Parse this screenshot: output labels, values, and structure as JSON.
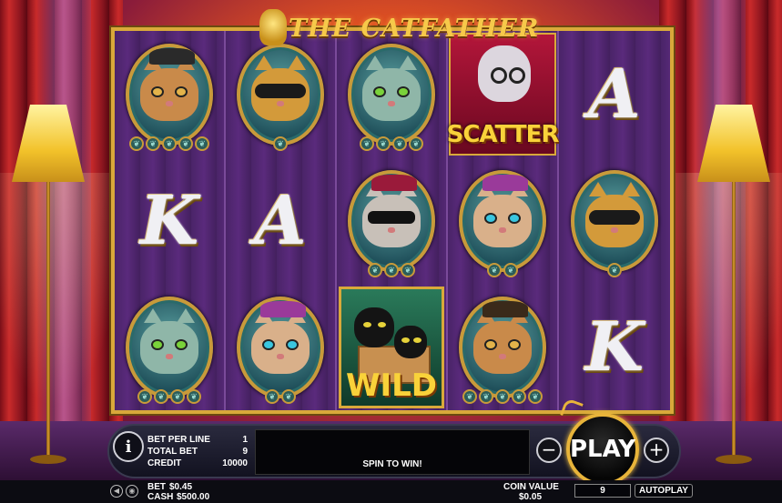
{
  "game": {
    "title": "THE CATFATHER"
  },
  "reels": [
    [
      {
        "symbol": "cat-monocle-bowler",
        "paw_count": 5,
        "colors": {
          "fur": "#c98a4a",
          "eye": "#e3b34a",
          "hat": "#2a2a2a"
        }
      },
      {
        "symbol": "letter",
        "text": "K"
      },
      {
        "symbol": "cat-tabby-green",
        "paw_count": 4,
        "colors": {
          "fur": "#8fb6a8",
          "eye": "#7ad23a"
        }
      }
    ],
    [
      {
        "symbol": "cat-masked-orange",
        "paw_count": 1,
        "colors": {
          "fur": "#d39a3a",
          "eye": "#f2a020"
        }
      },
      {
        "symbol": "letter",
        "text": "A"
      },
      {
        "symbol": "cat-siamese-beret",
        "paw_count": 2,
        "colors": {
          "fur": "#d9b08a",
          "eye": "#3ac6e0",
          "hat": "#9a3a9a"
        }
      }
    ],
    [
      {
        "symbol": "cat-tabby-green",
        "paw_count": 4,
        "colors": {
          "fur": "#8fb6a8",
          "eye": "#7ad23a"
        }
      },
      {
        "symbol": "cat-shades-cap",
        "paw_count": 3,
        "colors": {
          "fur": "#c8c0b8",
          "eye": "#111111",
          "hat": "#9a1a3a"
        }
      },
      {
        "symbol": "wild",
        "label": "WILD"
      }
    ],
    [
      {
        "symbol": "scatter",
        "label": "SCATTER"
      },
      {
        "symbol": "cat-siamese-beret",
        "paw_count": 2,
        "colors": {
          "fur": "#d9b08a",
          "eye": "#3ac6e0",
          "hat": "#9a3a9a"
        }
      },
      {
        "symbol": "cat-monocle-bowler",
        "paw_count": 5,
        "colors": {
          "fur": "#c98a4a",
          "eye": "#e3b34a",
          "hat": "#3a2a1a"
        }
      }
    ],
    [
      {
        "symbol": "letter",
        "text": "A"
      },
      {
        "symbol": "cat-masked-orange",
        "paw_count": 1,
        "colors": {
          "fur": "#d39a3a",
          "eye": "#f2a020"
        }
      },
      {
        "symbol": "letter",
        "text": "K"
      }
    ]
  ],
  "panel": {
    "info_label": "i",
    "bet_per_line_label": "BET PER LINE",
    "bet_per_line_value": "1",
    "total_bet_label": "TOTAL BET",
    "total_bet_value": "9",
    "credit_label": "CREDIT",
    "credit_value": "10000",
    "message": "SPIN TO WIN!",
    "minus_label": "−",
    "plus_label": "+",
    "play_label": "PLAY"
  },
  "footer": {
    "bet_label": "BET",
    "bet_value": "$0.45",
    "cash_label": "CASH",
    "cash_value": "$500.00",
    "coin_value_label": "COIN VALUE",
    "coin_value": "$0.05",
    "lines_value": "9",
    "autoplay_label": "AUTOPLAY"
  },
  "colors": {
    "gold": "#d9a93a",
    "reel_bg": "#4a2468",
    "accent_yellow": "#f9d23a"
  }
}
